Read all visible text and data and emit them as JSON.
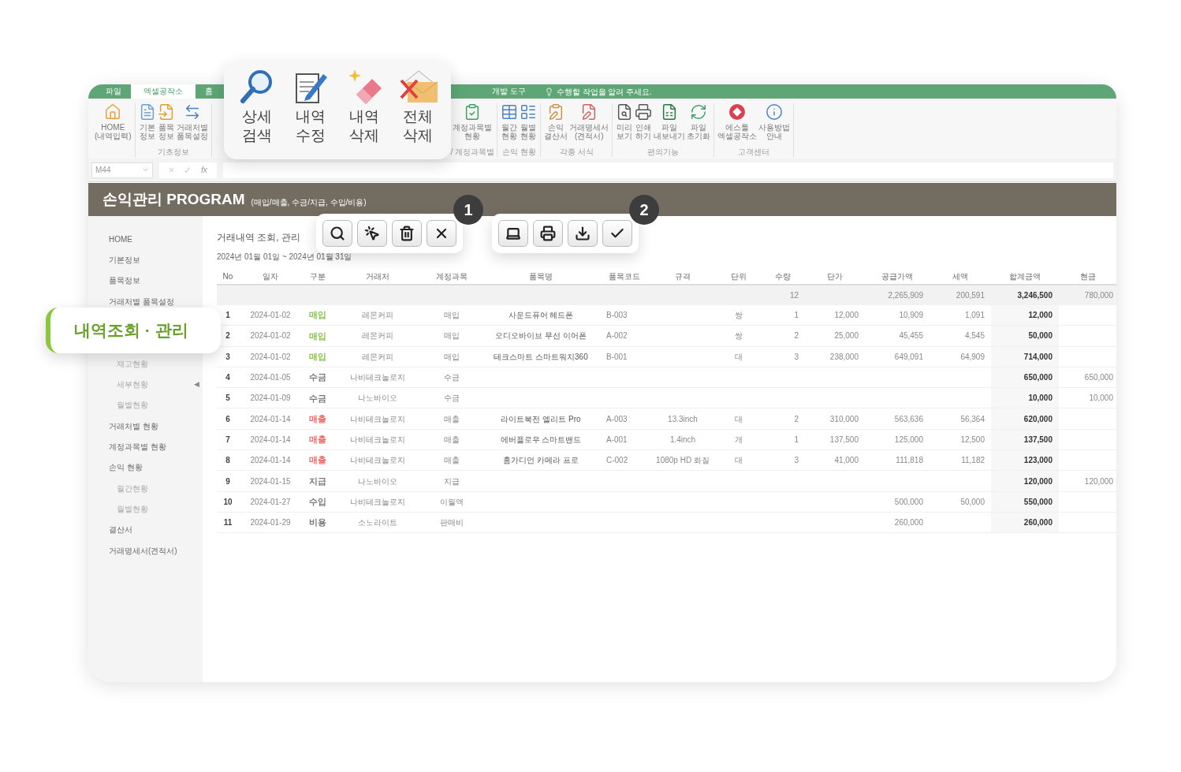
{
  "ribbon": {
    "tabs": [
      {
        "label": "파일",
        "selected": false
      },
      {
        "label": "엑셀공작소",
        "selected": true
      },
      {
        "label": "홈",
        "selected": false
      }
    ],
    "tabs_right": [
      {
        "label": "개발 도구",
        "selected": false
      }
    ],
    "tell_me": "수행할 작업을 알려 주세요.",
    "groups_left": [
      {
        "items": [
          "HOME\n(내역입력)"
        ]
      },
      {
        "label": "기초정보",
        "items": [
          "기본\n정보",
          "품목\n정보",
          "거래처별\n품목설정"
        ]
      }
    ],
    "groups_right": [
      {
        "label": "/ 계정과목별",
        "items": [
          "계정과목별\n현황"
        ]
      },
      {
        "label": "손익 현황",
        "items": [
          "월간\n현황",
          "월별\n현황"
        ]
      },
      {
        "label": "각종 서식",
        "items": [
          "손익\n결산서",
          "거래명세서\n(견적서)"
        ]
      },
      {
        "label": "편의기능",
        "items": [
          "미리\n보기",
          "인쇄\n하기",
          "파일\n내보내기",
          "파일\n초기화"
        ]
      },
      {
        "label": "고객센터",
        "items": [
          "에스툴\n엑셀공작소",
          "사용방법\n안내"
        ]
      }
    ]
  },
  "formula_bar": {
    "name_box": "M44",
    "cancel": "×",
    "enter": "✓",
    "fx": "fx"
  },
  "header": {
    "title": "손익관리 PROGRAM",
    "subtitle": "(매입/매출, 수금/지급, 수입/비용)"
  },
  "sidebar": {
    "items": [
      {
        "kind": "main",
        "label": "HOME"
      },
      {
        "kind": "main",
        "label": "기본정보"
      },
      {
        "kind": "main",
        "label": "품목정보"
      },
      {
        "kind": "main",
        "label": "거래처별 품목설정"
      },
      {
        "kind": "callout",
        "label": "내역조회 · 관리"
      },
      {
        "kind": "sub",
        "label": "재고현황"
      },
      {
        "kind": "sub",
        "label": "세부현황",
        "arrow": "◀"
      },
      {
        "kind": "sub",
        "label": "월별현황"
      },
      {
        "kind": "main",
        "label": "거래처별 현황"
      },
      {
        "kind": "main",
        "label": "계정과목별 현황"
      },
      {
        "kind": "main",
        "label": "손익 현황"
      },
      {
        "kind": "sub",
        "label": "월간현황"
      },
      {
        "kind": "sub",
        "label": "월별현황"
      },
      {
        "kind": "main",
        "label": "결산서"
      },
      {
        "kind": "main",
        "label": "거래명세서(견적서)"
      }
    ]
  },
  "content": {
    "title": "거래내역 조회, 관리",
    "period": "2024년 01월 01일 ~ 2024년 01월 31일"
  },
  "table": {
    "columns": [
      "No",
      "일자",
      "구분",
      "거래처",
      "계정과목",
      "품목명",
      "품목코드",
      "규격",
      "단위",
      "수량",
      "단가",
      "공급가액",
      "세액",
      "합계금액",
      "현금"
    ],
    "totals": {
      "qty": "12",
      "supply": "2,265,909",
      "tax": "200,591",
      "total": "3,246,500",
      "cash": "780,000"
    },
    "rows": [
      {
        "no": "1",
        "date": "2024-01-02",
        "type": "매입",
        "color": "#8bc34a",
        "client": "레몬커피",
        "account": "매입",
        "item": "사운드퓨어 헤드폰",
        "code": "B-003",
        "unit": "쌍",
        "qty": "1",
        "price": "12,000",
        "supply": "10,909",
        "tax": "1,091",
        "total": "12,000"
      },
      {
        "no": "2",
        "date": "2024-01-02",
        "type": "매입",
        "color": "#8bc34a",
        "client": "레몬커피",
        "account": "매입",
        "item": "오디오바이브 무선 이어폰",
        "code": "A-002",
        "unit": "쌍",
        "qty": "2",
        "price": "25,000",
        "supply": "45,455",
        "tax": "4,545",
        "total": "50,000"
      },
      {
        "no": "3",
        "date": "2024-01-02",
        "type": "매입",
        "color": "#8bc34a",
        "client": "레몬커피",
        "account": "매입",
        "item": "테크스마트 스마트워치360",
        "code": "B-001",
        "unit": "대",
        "qty": "3",
        "price": "238,000",
        "supply": "649,091",
        "tax": "64,909",
        "total": "714,000"
      },
      {
        "no": "4",
        "date": "2024-01-05",
        "type": "수금",
        "color": "#777777",
        "client": "나비테크놀로지",
        "account": "수금",
        "total": "650,000",
        "cash": "650,000"
      },
      {
        "no": "5",
        "date": "2024-01-09",
        "type": "수금",
        "color": "#777777",
        "client": "나노바이오",
        "account": "수금",
        "total": "10,000",
        "cash": "10,000"
      },
      {
        "no": "6",
        "date": "2024-01-14",
        "type": "매출",
        "color": "#f06a6a",
        "client": "나비테크놀로지",
        "account": "매출",
        "item": "라이트북전 엘리트 Pro",
        "code": "A-003",
        "spec": "13.3inch",
        "unit": "대",
        "qty": "2",
        "price": "310,000",
        "supply": "563,636",
        "tax": "56,364",
        "total": "620,000"
      },
      {
        "no": "7",
        "date": "2024-01-14",
        "type": "매출",
        "color": "#f06a6a",
        "client": "나비테크놀로지",
        "account": "매출",
        "item": "에버플로우 스마트밴드",
        "code": "A-001",
        "spec": "1.4inch",
        "unit": "개",
        "qty": "1",
        "price": "137,500",
        "supply": "125,000",
        "tax": "12,500",
        "total": "137,500"
      },
      {
        "no": "8",
        "date": "2024-01-14",
        "type": "매출",
        "color": "#f06a6a",
        "client": "나비테크놀로지",
        "account": "매출",
        "item": "홈가디언 카메라 프로",
        "code": "C-002",
        "spec": "1080p HD 화질",
        "unit": "대",
        "qty": "3",
        "price": "41,000",
        "supply": "111,818",
        "tax": "11,182",
        "total": "123,000"
      },
      {
        "no": "9",
        "date": "2024-01-15",
        "type": "지급",
        "color": "#777777",
        "client": "나노바이오",
        "account": "지급",
        "total": "120,000",
        "cash": "120,000"
      },
      {
        "no": "10",
        "date": "2024-01-27",
        "type": "수입",
        "color": "#777777",
        "client": "나비테크놀로지",
        "account": "이월액",
        "supply": "500,000",
        "tax": "50,000",
        "total": "550,000"
      },
      {
        "no": "11",
        "date": "2024-01-29",
        "type": "비용",
        "color": "#777777",
        "client": "소노라이트",
        "account": "판매비",
        "supply": "260,000",
        "total": "260,000"
      }
    ]
  },
  "feature_popup": {
    "buttons": [
      "상세\n검색",
      "내역\n수정",
      "내역\n삭제",
      "전체\n삭제"
    ]
  },
  "toolbars": [
    {
      "badge": "1"
    },
    {
      "badge": "2"
    }
  ]
}
